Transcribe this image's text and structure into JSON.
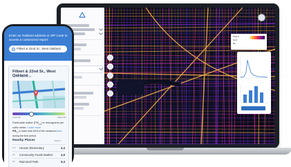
{
  "phone": {
    "prompt": "Enter an Oakland address or ZIP Code to access a customized report:",
    "search_value": "Filbert & 22nd St., West Oakland",
    "location_title": "Filbert & 22nd St., West Oakland",
    "date_range": "Apr 1 - June 2019",
    "scale_low": "Lower PM",
    "scale_high": "Higher PM",
    "pm_prefix": "Particulate matter (PM",
    "pm_sub": "2.5",
    "pm_suffix": ") in micrograms per cubic meter.",
    "learn_more": "Learn more",
    "note_prefix": "PM",
    "note_sub": "2.5",
    "note_body": " is lower than 84% of the measured ",
    "note_link": "area",
    "note_tail": " during the time period.",
    "nearby_heading": "Nearby Places",
    "nearby_unit": "PM2.5",
    "places": [
      {
        "rank": "2nd",
        "name": "Hoover Elementary",
        "value": "4.4"
      },
      {
        "rank": "4th",
        "name": "Community Foods Market",
        "value": "4.9"
      },
      {
        "rank": "6th",
        "name": "Raimondi Park",
        "value": "9.4"
      }
    ]
  },
  "legend": {
    "rows": [
      "PM2.5",
      "NO2",
      "BC"
    ],
    "ramp_colors": [
      "#ffe36a",
      "#ff8a3d",
      "#e6324e",
      "#8a1a8c",
      "#2d0b5a"
    ]
  },
  "colors": {
    "accent": "#3b7ed3",
    "map_bg": "#0d1020",
    "street_hot": "#ff3d8a",
    "street_cool": "#7a2bd8",
    "street_warm": "#ffb547"
  },
  "icons": [
    "app-logo-icon",
    "search-icon",
    "map-pin-icon",
    "layers-icon",
    "zoom-in-icon",
    "zoom-out-icon",
    "user-avatar-icon"
  ]
}
